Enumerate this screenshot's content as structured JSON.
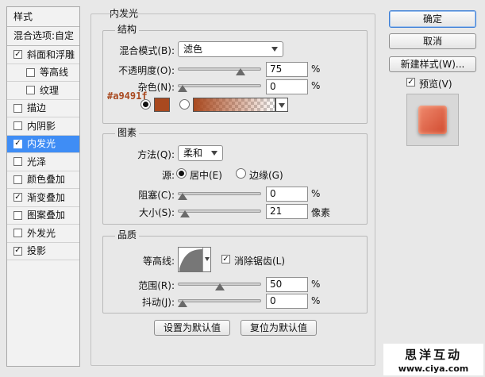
{
  "left_panel": {
    "header": "样式",
    "blend_options": "混合选项:自定",
    "items": [
      {
        "label": "斜面和浮雕",
        "checked": true,
        "indent": false,
        "active": false
      },
      {
        "label": "等高线",
        "checked": false,
        "indent": true,
        "active": false
      },
      {
        "label": "纹理",
        "checked": false,
        "indent": true,
        "active": false
      },
      {
        "label": "描边",
        "checked": false,
        "indent": false,
        "active": false
      },
      {
        "label": "内阴影",
        "checked": false,
        "indent": false,
        "active": false
      },
      {
        "label": "内发光",
        "checked": true,
        "indent": false,
        "active": true
      },
      {
        "label": "光泽",
        "checked": false,
        "indent": false,
        "active": false
      },
      {
        "label": "颜色叠加",
        "checked": false,
        "indent": false,
        "active": false
      },
      {
        "label": "渐变叠加",
        "checked": true,
        "indent": false,
        "active": false
      },
      {
        "label": "图案叠加",
        "checked": false,
        "indent": false,
        "active": false
      },
      {
        "label": "外发光",
        "checked": false,
        "indent": false,
        "active": false
      },
      {
        "label": "投影",
        "checked": true,
        "indent": false,
        "active": false
      }
    ]
  },
  "main": {
    "title": "内发光",
    "structure": {
      "title": "结构",
      "blend_mode_label": "混合模式(B):",
      "blend_mode_value": "滤色",
      "opacity_label": "不透明度(O):",
      "opacity_value": "75",
      "opacity_unit": "%",
      "opacity_fraction": 0.75,
      "noise_label": "杂色(N):",
      "noise_value": "0",
      "noise_unit": "%",
      "noise_fraction": 0,
      "color_hex_label": "#a9491f",
      "color_swatch": "#a9491f",
      "color_selected": true
    },
    "elements": {
      "title": "图素",
      "method_label": "方法(Q):",
      "method_value": "柔和",
      "source_label": "源:",
      "source_center": "居中(E)",
      "source_edge": "边缘(G)",
      "source_selected": "center",
      "choke_label": "阻塞(C):",
      "choke_value": "0",
      "choke_unit": "%",
      "choke_fraction": 0,
      "size_label": "大小(S):",
      "size_value": "21",
      "size_unit": "像素",
      "size_fraction": 0.085
    },
    "quality": {
      "title": "品质",
      "contour_label": "等高线:",
      "antialias_label": "消除锯齿(L)",
      "antialias_checked": true,
      "range_label": "范围(R):",
      "range_value": "50",
      "range_unit": "%",
      "range_fraction": 0.5,
      "jitter_label": "抖动(J):",
      "jitter_value": "0",
      "jitter_unit": "%",
      "jitter_fraction": 0
    },
    "set_default": "设置为默认值",
    "reset_default": "复位为默认值"
  },
  "right": {
    "ok": "确定",
    "cancel": "取消",
    "new_style": "新建样式(W)...",
    "preview_label": "预览(V)",
    "preview_checked": true
  },
  "watermark": {
    "brand": "思洋互动",
    "url": "www.ciya.com"
  },
  "colors": {
    "accent": "#3f8df5",
    "glow": "#a9491f",
    "background": "#e8e8e8"
  }
}
